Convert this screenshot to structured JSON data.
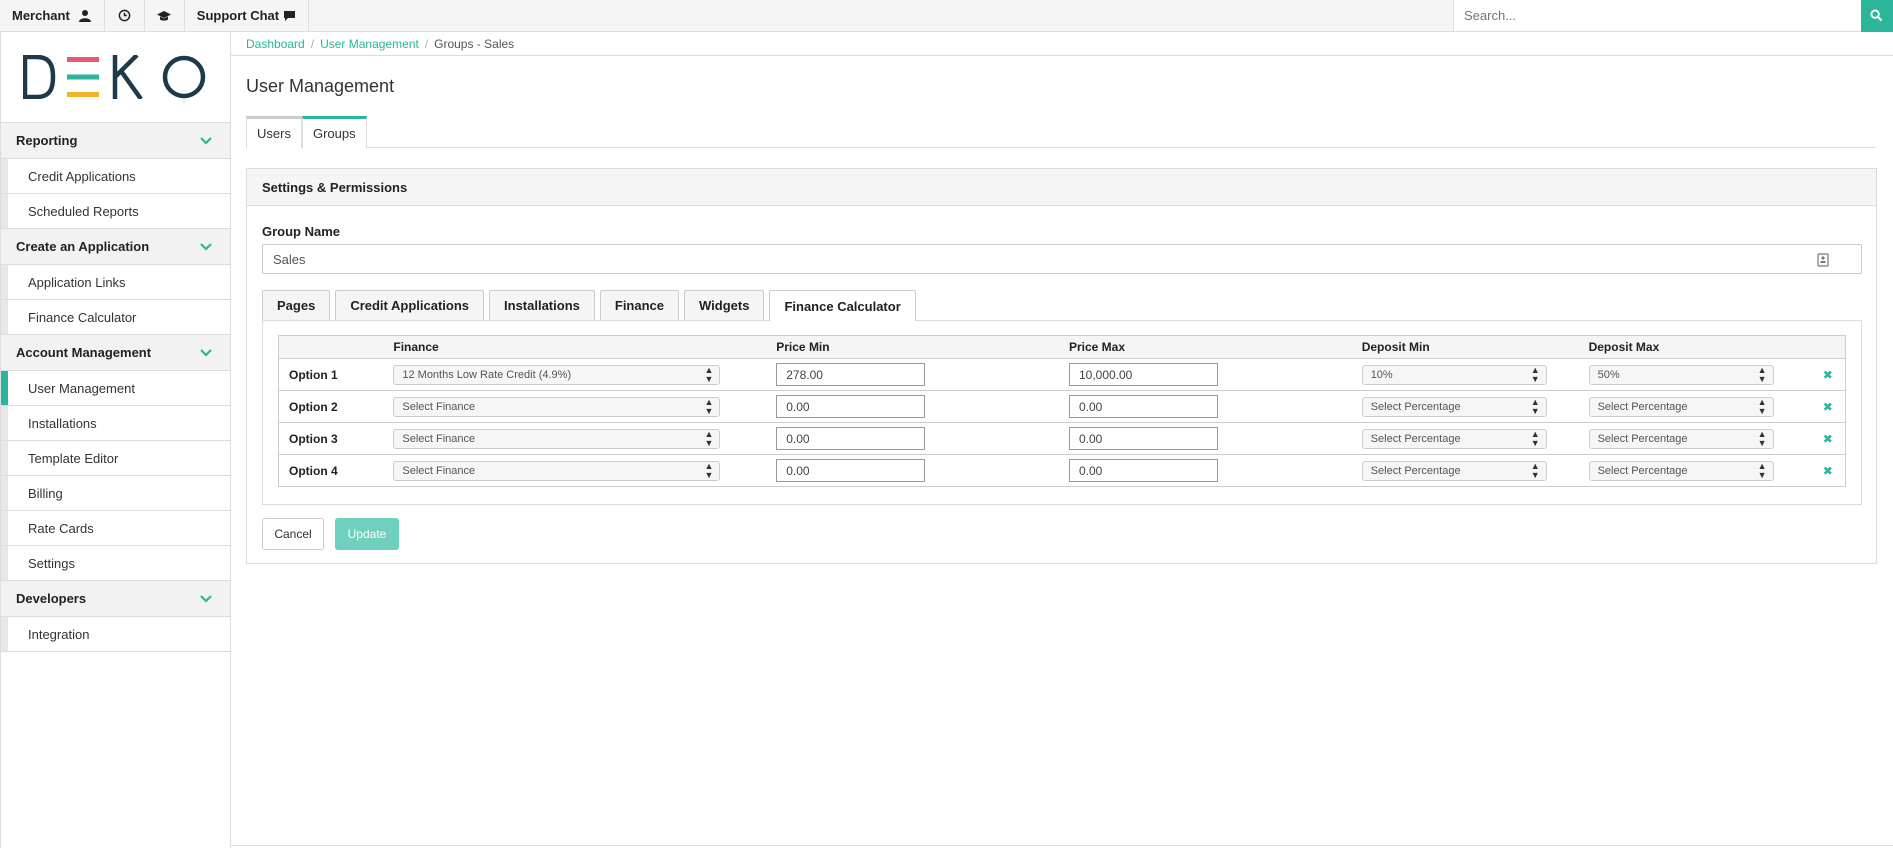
{
  "topbar": {
    "merchant_label": "Merchant",
    "support_chat_label": "Support Chat",
    "search_placeholder": "Search..."
  },
  "sidebar": {
    "logo_text": "DEKO",
    "sections": [
      {
        "label": "Reporting",
        "items": [
          "Credit Applications",
          "Scheduled Reports"
        ]
      },
      {
        "label": "Create an Application",
        "items": [
          "Application Links",
          "Finance Calculator"
        ]
      },
      {
        "label": "Account Management",
        "items": [
          "User Management",
          "Installations",
          "Template Editor",
          "Billing",
          "Rate Cards",
          "Settings"
        ]
      },
      {
        "label": "Developers",
        "items": [
          "Integration"
        ]
      }
    ],
    "active_item": "User Management"
  },
  "breadcrumb": {
    "items": [
      "Dashboard",
      "User Management"
    ],
    "current": "Groups - Sales"
  },
  "page": {
    "title": "User Management",
    "tabs": [
      "Users",
      "Groups"
    ],
    "active_tab": "Groups"
  },
  "panel": {
    "heading": "Settings & Permissions",
    "group_name_label": "Group Name",
    "group_name_value": "Sales",
    "tabs": [
      "Pages",
      "Credit Applications",
      "Installations",
      "Finance",
      "Widgets",
      "Finance Calculator"
    ],
    "active_tab": "Finance Calculator"
  },
  "calculator": {
    "headers": [
      "Finance",
      "Price Min",
      "Price Max",
      "Deposit Min",
      "Deposit Max"
    ],
    "rows": [
      {
        "label": "Option 1",
        "finance": "12 Months Low Rate Credit (4.9%)",
        "price_min": "278.00",
        "price_max": "10,000.00",
        "deposit_min": "10%",
        "deposit_max": "50%"
      },
      {
        "label": "Option 2",
        "finance": "Select Finance",
        "price_min": "0.00",
        "price_max": "0.00",
        "deposit_min": "Select Percentage",
        "deposit_max": "Select Percentage"
      },
      {
        "label": "Option 3",
        "finance": "Select Finance",
        "price_min": "0.00",
        "price_max": "0.00",
        "deposit_min": "Select Percentage",
        "deposit_max": "Select Percentage"
      },
      {
        "label": "Option 4",
        "finance": "Select Finance",
        "price_min": "0.00",
        "price_max": "0.00",
        "deposit_min": "Select Percentage",
        "deposit_max": "Select Percentage"
      }
    ]
  },
  "actions": {
    "cancel_label": "Cancel",
    "update_label": "Update"
  },
  "colors": {
    "accent": "#2bb59a",
    "logo_bar_pink": "#e85a71",
    "logo_bar_teal": "#2bb59a",
    "logo_bar_yellow": "#f0b429",
    "logo_text": "#1e3a4a"
  }
}
